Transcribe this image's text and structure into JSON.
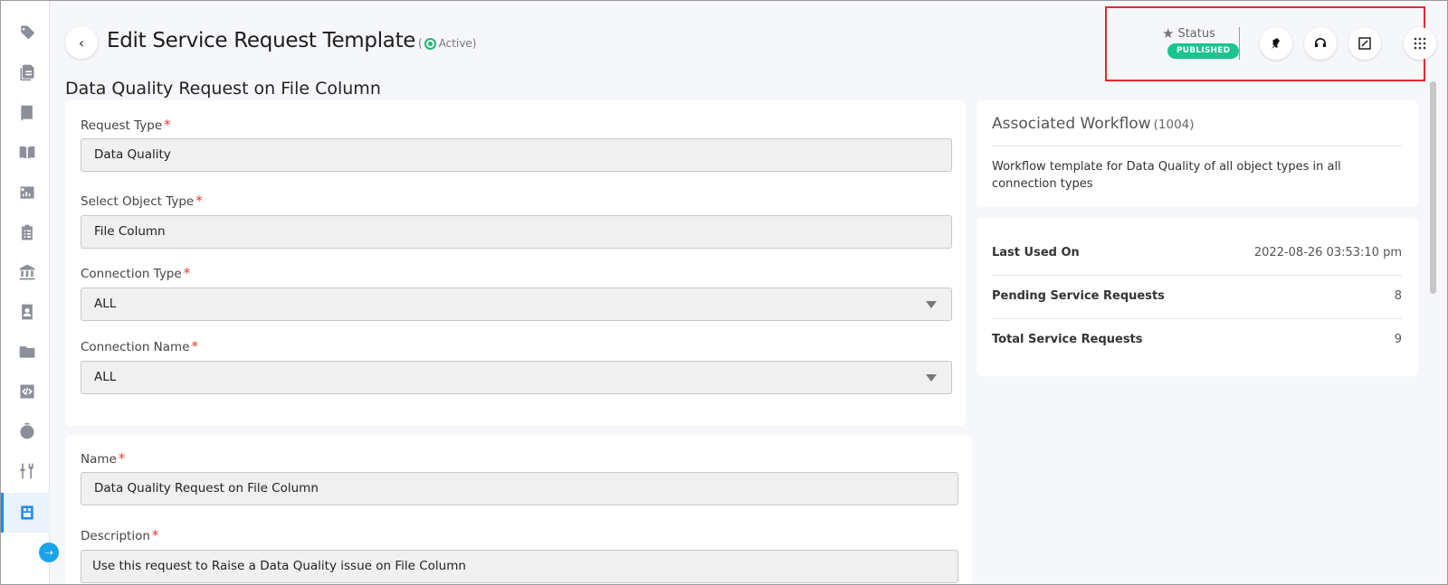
{
  "header": {
    "back_icon": "chevron-left-icon",
    "title": "Edit Service Request Template",
    "active_open": "(",
    "active_label": "Active)",
    "status_label": "Status",
    "status_badge": "PUBLISHED",
    "actions": [
      {
        "name": "push-pin-button",
        "icon": "push-pin-icon"
      },
      {
        "name": "headphones-button",
        "icon": "headphones-icon"
      },
      {
        "name": "edit-expand-button",
        "icon": "expand-edit-icon"
      },
      {
        "name": "more-apps-button",
        "icon": "grid-dots-icon"
      }
    ]
  },
  "subtitle": "Data Quality Request on File Column",
  "form": {
    "request_type": {
      "label": "Request Type",
      "required": "*",
      "value": "Data Quality"
    },
    "object_type": {
      "label": "Select Object Type",
      "required": "*",
      "value": "File Column"
    },
    "connection_type": {
      "label": "Connection Type",
      "required": "*",
      "value": "ALL"
    },
    "connection_name": {
      "label": "Connection Name",
      "required": "*",
      "value": "ALL"
    },
    "name": {
      "label": "Name",
      "required": "*",
      "value": "Data Quality Request on File Column"
    },
    "description": {
      "label": "Description",
      "required": "*",
      "value": "Use this request to Raise a Data Quality issue on File Column"
    }
  },
  "workflow": {
    "title": "Associated Workflow",
    "count": "(1004)",
    "description": "Workflow template for Data Quality of all object types in all connection types"
  },
  "stats": [
    {
      "label": "Last Used On",
      "value": "2022-08-26 03:53:10 pm"
    },
    {
      "label": "Pending Service Requests",
      "value": "8"
    },
    {
      "label": "Total Service Requests",
      "value": "9"
    }
  ],
  "sidebar": {
    "items": [
      {
        "name": "tag-icon"
      },
      {
        "name": "documents-icon"
      },
      {
        "name": "book-icon"
      },
      {
        "name": "open-book-icon"
      },
      {
        "name": "dashboard-icon"
      },
      {
        "name": "clipboard-icon"
      },
      {
        "name": "bank-icon"
      },
      {
        "name": "contact-book-icon"
      },
      {
        "name": "folder-icon"
      },
      {
        "name": "code-icon"
      },
      {
        "name": "timer-icon"
      },
      {
        "name": "tools-icon"
      },
      {
        "name": "service-request-icon"
      }
    ],
    "active_index": 12,
    "collapse_icon": "arrow-right-icon"
  },
  "colors": {
    "accent": "#1e88e5",
    "published": "#19c48f",
    "active": "#22b573",
    "required": "#e53935",
    "highlight": "#e12b2b"
  }
}
